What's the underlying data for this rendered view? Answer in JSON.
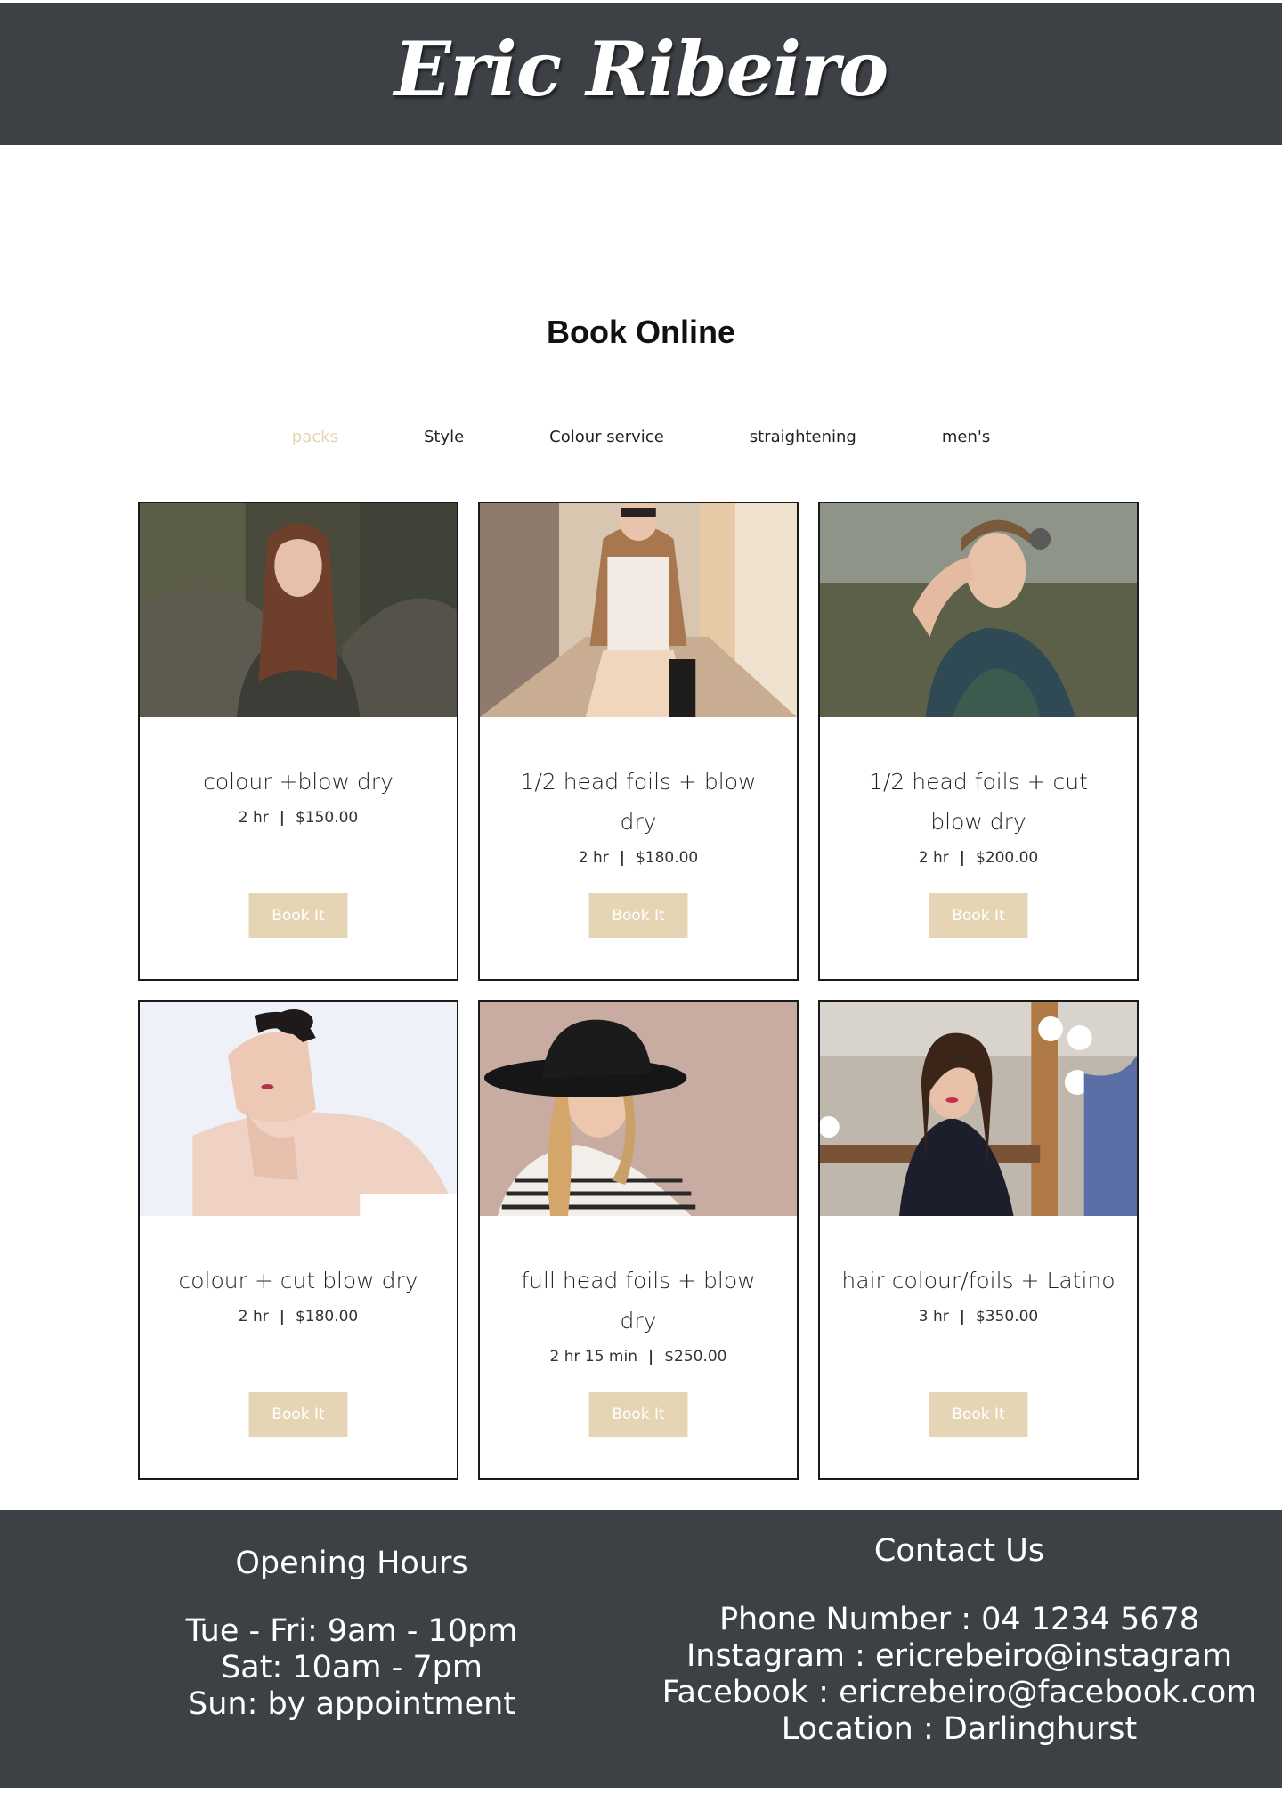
{
  "header": {
    "site_title": "Eric Ribeiro"
  },
  "main": {
    "heading": "Book Online",
    "tabs": [
      {
        "label": "packs",
        "active": true
      },
      {
        "label": "Style",
        "active": false
      },
      {
        "label": "Colour service",
        "active": false
      },
      {
        "label": "straightening",
        "active": false
      },
      {
        "label": "men's",
        "active": false
      }
    ],
    "services": [
      {
        "title": "colour +blow dry",
        "duration": "2 hr",
        "price": "$150.00",
        "button": "Book It"
      },
      {
        "title": "1/2 head foils + blow dry",
        "duration": "2 hr",
        "price": "$180.00",
        "button": "Book It"
      },
      {
        "title": "1/2 head foils + cut blow dry",
        "duration": "2 hr",
        "price": "$200.00",
        "button": "Book It"
      },
      {
        "title": "colour + cut blow dry",
        "duration": "2 hr",
        "price": "$180.00",
        "button": "Book It"
      },
      {
        "title": "full head foils + blow dry",
        "duration": "2 hr 15 min",
        "price": "$250.00",
        "button": "Book It"
      },
      {
        "title": "hair colour/foils + Latino",
        "duration": "3 hr",
        "price": "$350.00",
        "button": "Book It"
      }
    ]
  },
  "footer": {
    "hours_title": "Opening Hours",
    "hours": [
      "Tue - Fri: 9am - 10pm",
      "Sat: 10am - 7pm",
      "Sun: by appointment"
    ],
    "contact_title": "Contact Us",
    "contact": [
      "Phone Number : 04 1234 5678",
      "Instagram : ericrebeiro@instagram",
      "Facebook : ericrebeiro@facebook.com",
      "Location : Darlinghurst"
    ]
  },
  "colors": {
    "header_bg": "#3d4145",
    "accent": "#e6d5b4",
    "text": "#222222"
  }
}
